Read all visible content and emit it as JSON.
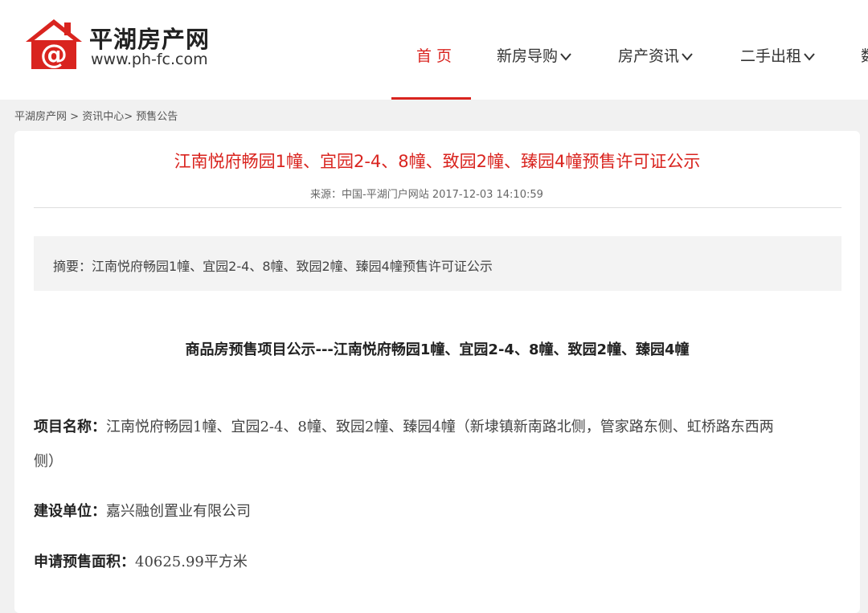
{
  "header": {
    "logo_name": "平湖房产网",
    "logo_url": "www.ph-fc.com",
    "logo_color": "#d9241f",
    "nav": [
      {
        "label": "首 页",
        "active": true
      },
      {
        "label": "新房导购",
        "dropdown": true
      },
      {
        "label": "房产资讯",
        "dropdown": true
      },
      {
        "label": "二手出租",
        "dropdown": true
      },
      {
        "label": "数"
      }
    ]
  },
  "breadcrumb": {
    "home": "平湖房产网",
    "sep1": " > ",
    "section": "资讯中心>",
    "current": " 预售公告"
  },
  "article": {
    "title": "江南悦府畅园1幢、宜园2-4、8幢、致园2幢、臻园4幢预售许可证公示",
    "meta": "来源：中国-平湖门户网站  2017-12-03 14:10:59",
    "summary": "摘要：江南悦府畅园1幢、宜园2-4、8幢、致园2幢、臻园4幢预售许可证公示",
    "heading": "商品房预售项目公示---江南悦府畅园1幢、宜园2-4、8幢、致园2幢、臻园4幢",
    "fields": {
      "project_label": "项目名称：",
      "project_value_line1": "江南悦府畅园1幢、宜园2-4、8幢、致园2幢、臻园4幢（新埭镇新南路北侧，管家路东侧、虹桥路东西两",
      "project_value_line2": "侧）",
      "builder_label": "建设单位：",
      "builder_value": "嘉兴融创置业有限公司",
      "area_label": "申请预售面积：",
      "area_value": "40625.99平方米"
    }
  }
}
